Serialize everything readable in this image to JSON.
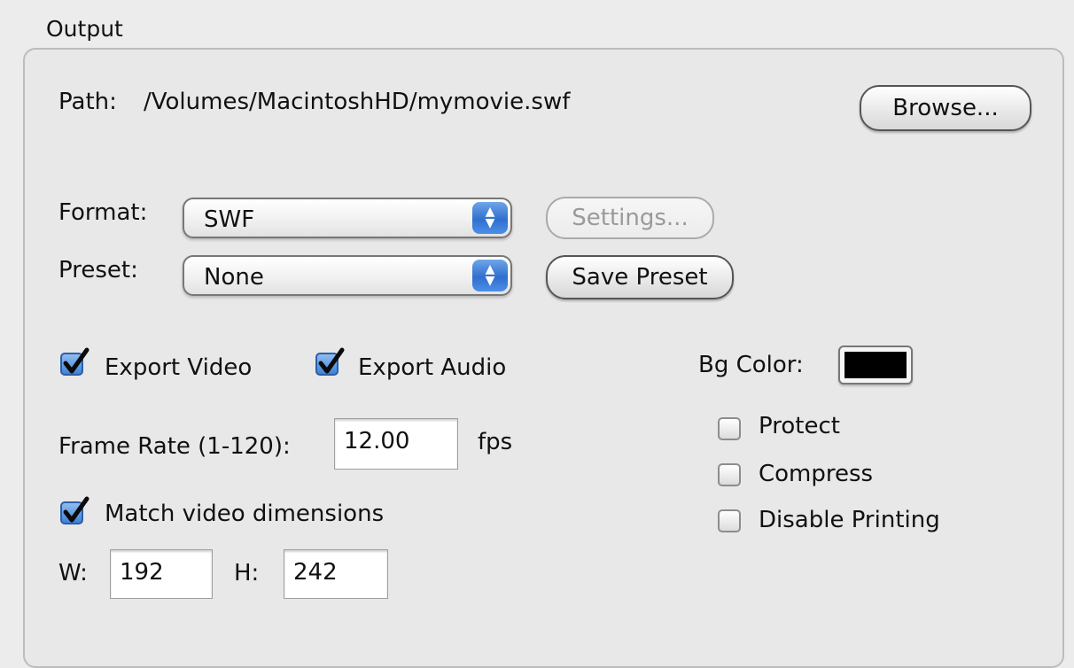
{
  "group": {
    "title": "Output"
  },
  "path": {
    "label": "Path:",
    "value": "/Volumes/MacintoshHD/mymovie.swf"
  },
  "browse_button": "Browse...",
  "format": {
    "label": "Format:",
    "selected": "SWF"
  },
  "settings_button": "Settings...",
  "preset": {
    "label": "Preset:",
    "selected": "None"
  },
  "save_preset_button": "Save Preset",
  "export_video": {
    "label": "Export Video",
    "checked": true
  },
  "export_audio": {
    "label": "Export Audio",
    "checked": true
  },
  "bg_color": {
    "label": "Bg Color:",
    "value": "#000000"
  },
  "frame_rate": {
    "label": "Frame Rate (1-120):",
    "value": "12.00",
    "unit": "fps"
  },
  "match_dimensions": {
    "label": "Match video dimensions",
    "checked": true
  },
  "width": {
    "label": "W:",
    "value": "192"
  },
  "height": {
    "label": "H:",
    "value": "242"
  },
  "options": [
    {
      "label": "Protect",
      "checked": false
    },
    {
      "label": "Compress",
      "checked": false
    },
    {
      "label": "Disable Printing",
      "checked": false
    }
  ]
}
